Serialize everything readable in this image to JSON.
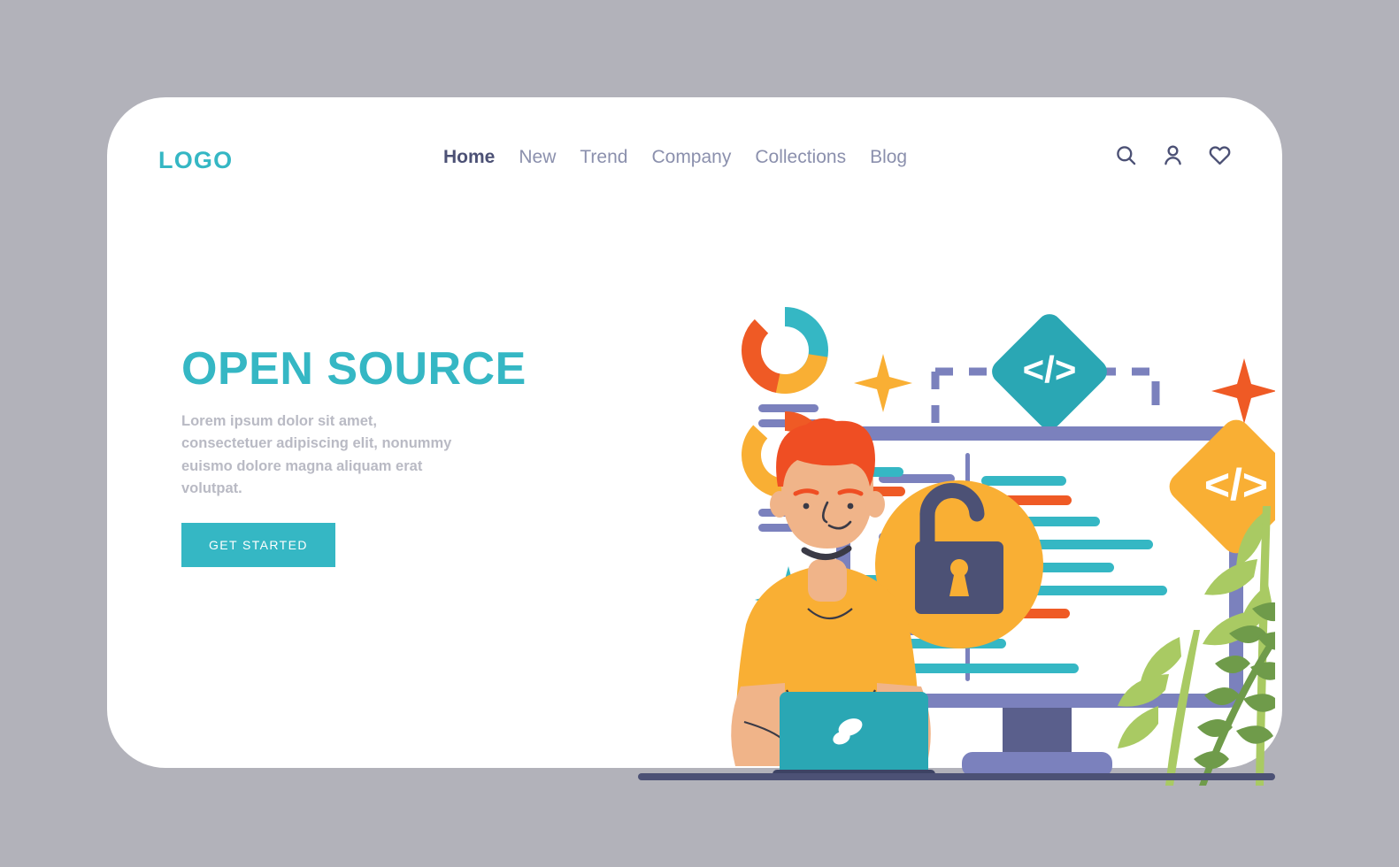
{
  "page": {
    "background_color": "#b2b2ba",
    "card_color": "#ffffff"
  },
  "header": {
    "logo": "LOGO",
    "nav": [
      {
        "label": "Home",
        "active": true
      },
      {
        "label": "New",
        "active": false
      },
      {
        "label": "Trend",
        "active": false
      },
      {
        "label": "Company",
        "active": false
      },
      {
        "label": "Collections",
        "active": false
      },
      {
        "label": "Blog",
        "active": false
      }
    ],
    "icons": [
      {
        "name": "search-icon",
        "label": "Search"
      },
      {
        "name": "user-icon",
        "label": "Account"
      },
      {
        "name": "heart-icon",
        "label": "Favorites"
      }
    ]
  },
  "hero": {
    "title": "OPEN SOURCE",
    "paragraph": "Lorem ipsum dolor sit amet, consectetuer adipiscing elit, nonummy euismo dolore magna aliquam erat volutpat.",
    "cta_label": "GET STARTED"
  },
  "colors": {
    "teal": "#35b7c4",
    "teal_dark": "#2aa7b4",
    "amber": "#f9af34",
    "orange": "#ef5a25",
    "purple": "#7b81bd",
    "slate": "#4c5175",
    "green_light": "#a9ca63",
    "green_dark": "#6f9b4a",
    "skin": "#f0b489",
    "hair": "#ef4e23",
    "nav_text": "#8b90ad",
    "body_text": "#b9bac4",
    "white": "#ffffff"
  },
  "illustration": {
    "name": "open-source-developer-illustration",
    "elements": [
      {
        "name": "donut-chart-top",
        "segments": [
          "teal",
          "amber",
          "orange"
        ]
      },
      {
        "name": "donut-chart-bottom",
        "segments": [
          "amber",
          "orange",
          "teal"
        ]
      },
      {
        "name": "stat-bar-lines",
        "count": 4,
        "color": "#7b81bd"
      },
      {
        "name": "code-badge-teal",
        "glyph": "</>"
      },
      {
        "name": "code-badge-amber",
        "glyph": "</>"
      },
      {
        "name": "dashed-connector",
        "color": "#7b81bd"
      },
      {
        "name": "star-amber",
        "color": "#f9af34"
      },
      {
        "name": "star-orange",
        "color": "#ef5a25"
      },
      {
        "name": "star-teal",
        "color": "#35b7c4"
      },
      {
        "name": "desktop-monitor",
        "frame_color": "#7b81bd"
      },
      {
        "name": "unlocked-padlock-badge",
        "circle_color": "#f9af34",
        "lock_color": "#4c5175"
      },
      {
        "name": "developer-character",
        "shirt": "#f9af34",
        "hair": "#ef4e23"
      },
      {
        "name": "laptop",
        "color": "#2aa7b4"
      },
      {
        "name": "plant-left",
        "color": "#a9ca63"
      },
      {
        "name": "plant-right",
        "color": "#6f9b4a"
      },
      {
        "name": "ground-line",
        "color": "#4c5175"
      }
    ]
  }
}
